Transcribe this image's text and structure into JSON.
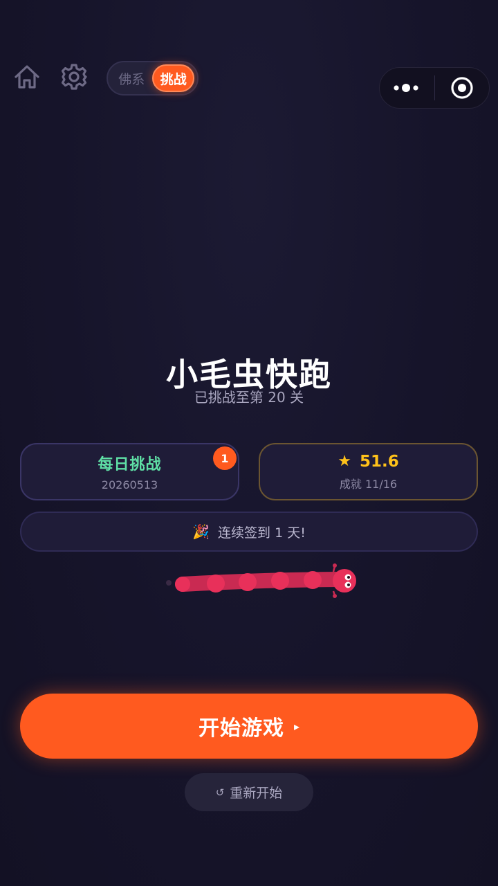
{
  "header": {
    "mode_options": [
      "佛系",
      "挑战"
    ],
    "active_mode": "挑战"
  },
  "game": {
    "title": "小毛虫快跑",
    "progress_text": "已挑战至第 20 关"
  },
  "daily_challenge": {
    "label": "每日挑战",
    "date": "20260513",
    "badge_count": "1"
  },
  "achievements": {
    "score": "51.6",
    "count_text": "成就 11/16"
  },
  "checkin": {
    "icon": "🎉",
    "text": "连续签到 1 天!"
  },
  "buttons": {
    "start_label": "开始游戏",
    "start_icon": "▸",
    "restart_icon": "↺",
    "restart_label": "重新开始"
  },
  "colors": {
    "accent": "#ff5a1f",
    "daily_text": "#5fe0a6",
    "gold": "#ffc21a",
    "caterpillar": "#e8305a",
    "background": "#16142a"
  },
  "icons": [
    "home-icon",
    "gear-icon",
    "more-dots-icon",
    "close-target-icon",
    "star-icon",
    "party-icon",
    "play-icon",
    "refresh-icon"
  ]
}
